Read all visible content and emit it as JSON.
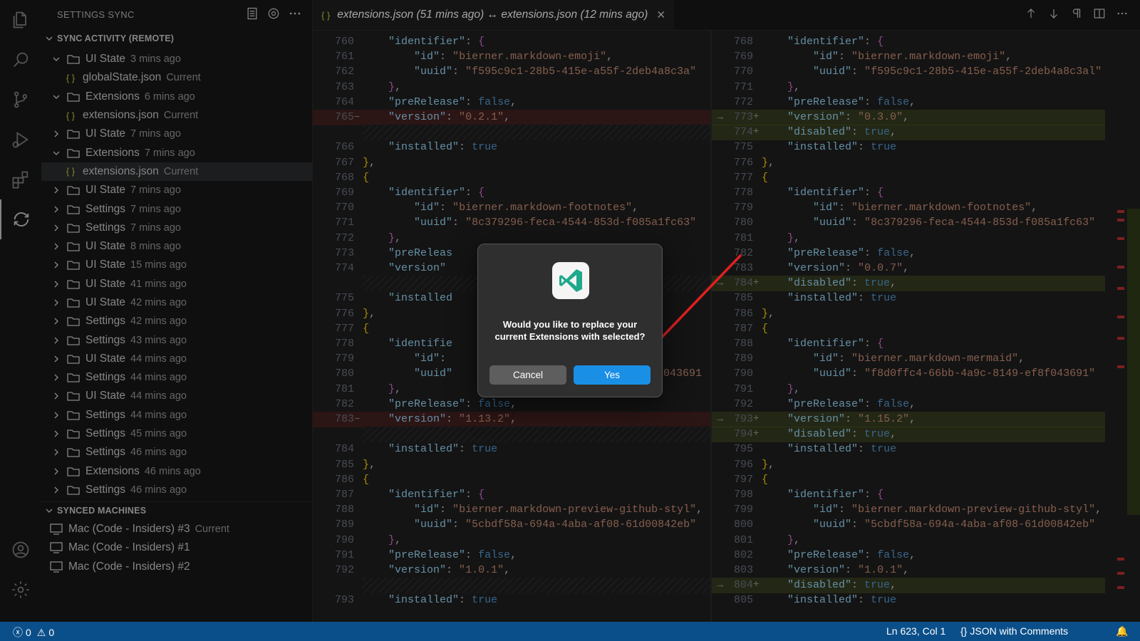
{
  "activity_bar": {
    "icons": [
      "files-icon",
      "search-icon",
      "source-control-icon",
      "run-debug-icon",
      "extensions-icon",
      "sync-icon",
      "account-icon",
      "gear-icon"
    ]
  },
  "sidebar": {
    "title": "SETTINGS SYNC",
    "sync_activity_header": "SYNC ACTIVITY (REMOTE)",
    "items": [
      {
        "label": "UI State",
        "desc": "3 mins ago",
        "level": 1,
        "expanded": true,
        "type": "folder"
      },
      {
        "label": "globalState.json",
        "desc": "Current",
        "level": 2,
        "type": "file"
      },
      {
        "label": "Extensions",
        "desc": "6 mins ago",
        "level": 1,
        "expanded": true,
        "type": "folder"
      },
      {
        "label": "extensions.json",
        "desc": "Current",
        "level": 2,
        "type": "file"
      },
      {
        "label": "UI State",
        "desc": "7 mins ago",
        "level": 1,
        "expanded": false,
        "type": "folder"
      },
      {
        "label": "Extensions",
        "desc": "7 mins ago",
        "level": 1,
        "expanded": true,
        "type": "folder"
      },
      {
        "label": "extensions.json",
        "desc": "Current",
        "level": 2,
        "type": "file",
        "selected": true
      },
      {
        "label": "UI State",
        "desc": "7 mins ago",
        "level": 1,
        "expanded": false,
        "type": "folder"
      },
      {
        "label": "Settings",
        "desc": "7 mins ago",
        "level": 1,
        "expanded": false,
        "type": "folder"
      },
      {
        "label": "Settings",
        "desc": "7 mins ago",
        "level": 1,
        "expanded": false,
        "type": "folder"
      },
      {
        "label": "UI State",
        "desc": "8 mins ago",
        "level": 1,
        "expanded": false,
        "type": "folder"
      },
      {
        "label": "UI State",
        "desc": "15 mins ago",
        "level": 1,
        "expanded": false,
        "type": "folder"
      },
      {
        "label": "UI State",
        "desc": "41 mins ago",
        "level": 1,
        "expanded": false,
        "type": "folder"
      },
      {
        "label": "UI State",
        "desc": "42 mins ago",
        "level": 1,
        "expanded": false,
        "type": "folder"
      },
      {
        "label": "Settings",
        "desc": "42 mins ago",
        "level": 1,
        "expanded": false,
        "type": "folder"
      },
      {
        "label": "Settings",
        "desc": "43 mins ago",
        "level": 1,
        "expanded": false,
        "type": "folder"
      },
      {
        "label": "UI State",
        "desc": "44 mins ago",
        "level": 1,
        "expanded": false,
        "type": "folder"
      },
      {
        "label": "Settings",
        "desc": "44 mins ago",
        "level": 1,
        "expanded": false,
        "type": "folder"
      },
      {
        "label": "UI State",
        "desc": "44 mins ago",
        "level": 1,
        "expanded": false,
        "type": "folder"
      },
      {
        "label": "Settings",
        "desc": "44 mins ago",
        "level": 1,
        "expanded": false,
        "type": "folder"
      },
      {
        "label": "Settings",
        "desc": "45 mins ago",
        "level": 1,
        "expanded": false,
        "type": "folder"
      },
      {
        "label": "Settings",
        "desc": "46 mins ago",
        "level": 1,
        "expanded": false,
        "type": "folder"
      },
      {
        "label": "Extensions",
        "desc": "46 mins ago",
        "level": 1,
        "expanded": false,
        "type": "folder"
      },
      {
        "label": "Settings",
        "desc": "46 mins ago",
        "level": 1,
        "expanded": false,
        "type": "folder"
      }
    ],
    "synced_machines_header": "SYNCED MACHINES",
    "machines": [
      {
        "label": "Mac (Code - Insiders) #3",
        "desc": "Current"
      },
      {
        "label": "Mac (Code - Insiders) #1",
        "desc": ""
      },
      {
        "label": "Mac (Code - Insiders) #2",
        "desc": ""
      }
    ]
  },
  "editor": {
    "tab_title": "extensions.json (51 mins ago) ↔ extensions.json (12 mins ago)",
    "left_lines": [
      {
        "n": "760",
        "t": "identifier_open"
      },
      {
        "n": "761",
        "t": "id",
        "v": "bierner.markdown-emoji"
      },
      {
        "n": "762",
        "t": "uuid",
        "v": "f595c9c1-28b5-415e-a55f-2deb4a8c3a"
      },
      {
        "n": "763",
        "t": "close_obj"
      },
      {
        "n": "764",
        "t": "prerelease"
      },
      {
        "n": "765",
        "t": "version",
        "v": "0.2.1",
        "mark": "removed"
      },
      {
        "n": "",
        "t": "hatch"
      },
      {
        "n": "766",
        "t": "installed"
      },
      {
        "n": "767",
        "t": "close_outer"
      },
      {
        "n": "768",
        "t": "open_outer"
      },
      {
        "n": "769",
        "t": "identifier_open"
      },
      {
        "n": "770",
        "t": "id",
        "v": "bierner.markdown-footnotes"
      },
      {
        "n": "771",
        "t": "uuid",
        "v": "8c379296-feca-4544-853d-f085a1fc63"
      },
      {
        "n": "772",
        "t": "close_obj"
      },
      {
        "n": "773",
        "t": "prerelease_partial",
        "v": "\"preReleas"
      },
      {
        "n": "774",
        "t": "version_partial",
        "v": "\"version\""
      },
      {
        "n": "",
        "t": "hatch"
      },
      {
        "n": "775",
        "t": "installed_partial",
        "v": "\"installed"
      },
      {
        "n": "776",
        "t": "close_outer"
      },
      {
        "n": "777",
        "t": "open_outer"
      },
      {
        "n": "778",
        "t": "identifier_partial",
        "v": "\"identifie"
      },
      {
        "n": "779",
        "t": "id_partial",
        "v": "\"id\":"
      },
      {
        "n": "780",
        "t": "uuid_partial",
        "v": "\"uuid\"",
        "tail": "3f043691"
      },
      {
        "n": "781",
        "t": "close_obj"
      },
      {
        "n": "782",
        "t": "prerelease"
      },
      {
        "n": "783",
        "t": "version",
        "v": "1.13.2",
        "mark": "removed"
      },
      {
        "n": "",
        "t": "hatch"
      },
      {
        "n": "784",
        "t": "installed"
      },
      {
        "n": "785",
        "t": "close_outer"
      },
      {
        "n": "786",
        "t": "open_outer"
      },
      {
        "n": "787",
        "t": "identifier_open"
      },
      {
        "n": "788",
        "t": "id",
        "v": "bierner.markdown-preview-github-styl"
      },
      {
        "n": "789",
        "t": "uuid",
        "v": "5cbdf58a-694a-4aba-af08-61d00842eb"
      },
      {
        "n": "790",
        "t": "close_obj"
      },
      {
        "n": "791",
        "t": "prerelease"
      },
      {
        "n": "792",
        "t": "version",
        "v": "1.0.1"
      },
      {
        "n": "",
        "t": "hatch"
      },
      {
        "n": "793",
        "t": "installed"
      }
    ],
    "right_lines": [
      {
        "n": "768",
        "t": "identifier_open"
      },
      {
        "n": "769",
        "t": "id",
        "v": "bierner.markdown-emoji"
      },
      {
        "n": "770",
        "t": "uuid",
        "v": "f595c9c1-28b5-415e-a55f-2deb4a8c3al"
      },
      {
        "n": "771",
        "t": "close_obj"
      },
      {
        "n": "772",
        "t": "prerelease"
      },
      {
        "n": "773",
        "t": "version",
        "v": "0.3.0",
        "mark": "added",
        "arrow": true
      },
      {
        "n": "774",
        "t": "disabled",
        "mark": "added"
      },
      {
        "n": "775",
        "t": "installed"
      },
      {
        "n": "776",
        "t": "close_outer"
      },
      {
        "n": "777",
        "t": "open_outer"
      },
      {
        "n": "778",
        "t": "identifier_open"
      },
      {
        "n": "779",
        "t": "id",
        "v": "bierner.markdown-footnotes"
      },
      {
        "n": "780",
        "t": "uuid",
        "v": "8c379296-feca-4544-853d-f085a1fc63"
      },
      {
        "n": "781",
        "t": "close_obj"
      },
      {
        "n": "782",
        "t": "prerelease"
      },
      {
        "n": "783",
        "t": "version",
        "v": "0.0.7"
      },
      {
        "n": "784",
        "t": "disabled",
        "mark": "added",
        "arrow": true
      },
      {
        "n": "785",
        "t": "installed"
      },
      {
        "n": "786",
        "t": "close_outer"
      },
      {
        "n": "787",
        "t": "open_outer"
      },
      {
        "n": "788",
        "t": "identifier_open"
      },
      {
        "n": "789",
        "t": "id",
        "v": "bierner.markdown-mermaid"
      },
      {
        "n": "790",
        "t": "uuid",
        "v": "f8d0ffc4-66bb-4a9c-8149-ef8f043691"
      },
      {
        "n": "791",
        "t": "close_obj"
      },
      {
        "n": "792",
        "t": "prerelease"
      },
      {
        "n": "793",
        "t": "version",
        "v": "1.15.2",
        "mark": "added",
        "arrow": true
      },
      {
        "n": "794",
        "t": "disabled",
        "mark": "added"
      },
      {
        "n": "795",
        "t": "installed"
      },
      {
        "n": "796",
        "t": "close_outer"
      },
      {
        "n": "797",
        "t": "open_outer"
      },
      {
        "n": "798",
        "t": "identifier_open"
      },
      {
        "n": "799",
        "t": "id",
        "v": "bierner.markdown-preview-github-styl"
      },
      {
        "n": "800",
        "t": "uuid",
        "v": "5cbdf58a-694a-4aba-af08-61d00842eb"
      },
      {
        "n": "801",
        "t": "close_obj"
      },
      {
        "n": "802",
        "t": "prerelease"
      },
      {
        "n": "803",
        "t": "version",
        "v": "1.0.1"
      },
      {
        "n": "804",
        "t": "disabled",
        "mark": "added",
        "arrow": true
      },
      {
        "n": "805",
        "t": "installed"
      }
    ]
  },
  "dialog": {
    "message": "Would you like to replace your current Extensions with selected?",
    "cancel_label": "Cancel",
    "yes_label": "Yes"
  },
  "status_bar": {
    "errors": "0",
    "warnings": "0",
    "cursor": "Ln 623, Col 1",
    "language": "JSON with Comments"
  },
  "colors": {
    "accent": "#1a8fe6",
    "status_bar": "#0b4f8a",
    "arrow": "#e02020"
  }
}
